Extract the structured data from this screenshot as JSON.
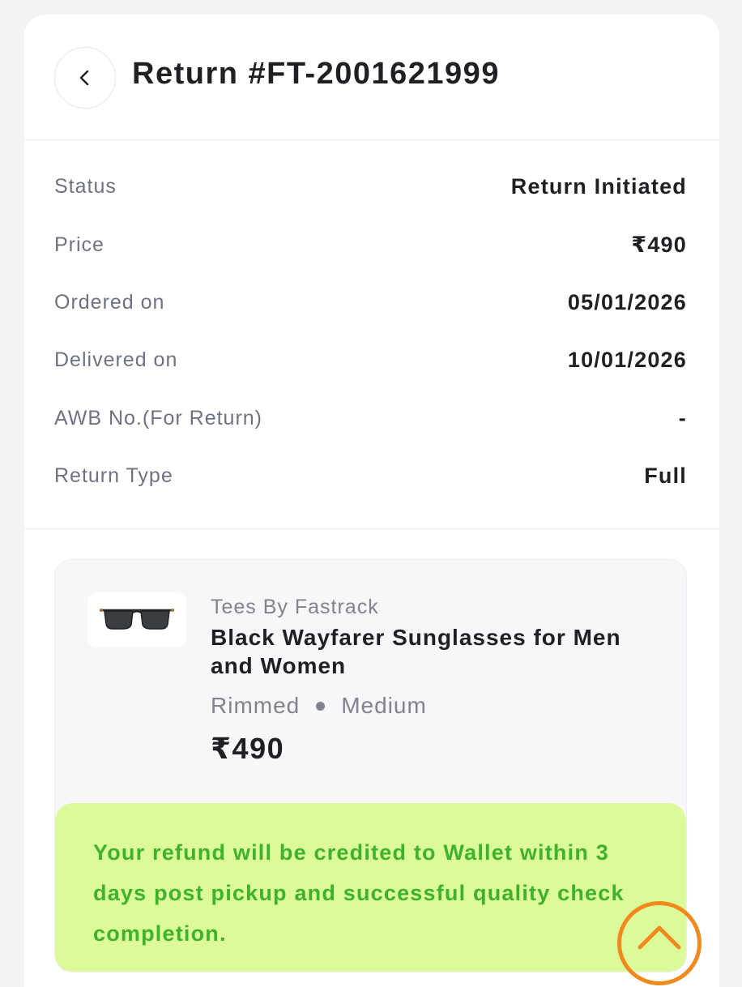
{
  "header": {
    "back_icon": "chevron-left-icon",
    "title": "Return #FT-2001621999"
  },
  "details": [
    {
      "label": "Status",
      "value": "Return Initiated"
    },
    {
      "label": "Price",
      "value": "₹490"
    },
    {
      "label": "Ordered on",
      "value": "05/01/2026"
    },
    {
      "label": "Delivered on",
      "value": "10/01/2026"
    },
    {
      "label": "AWB No.(For Return)",
      "value": "-"
    },
    {
      "label": "Return Type",
      "value": "Full"
    }
  ],
  "item": {
    "brand": "Tees By Fastrack",
    "name": "Black Wayfarer Sunglasses for Men and Women",
    "frame": "Rimmed",
    "size": "Medium",
    "price": "₹490",
    "image_icon": "sunglasses-icon"
  },
  "refund": {
    "message": "Your refund will be credited to Wallet within 3 days post pickup and successful quality check completion."
  },
  "scroll_top_icon": "chevron-up-icon",
  "colors": {
    "accent_green_bg": "#ddfa9b",
    "accent_green_text": "#3db22a",
    "scroll_button_orange": "#f08a1c"
  }
}
